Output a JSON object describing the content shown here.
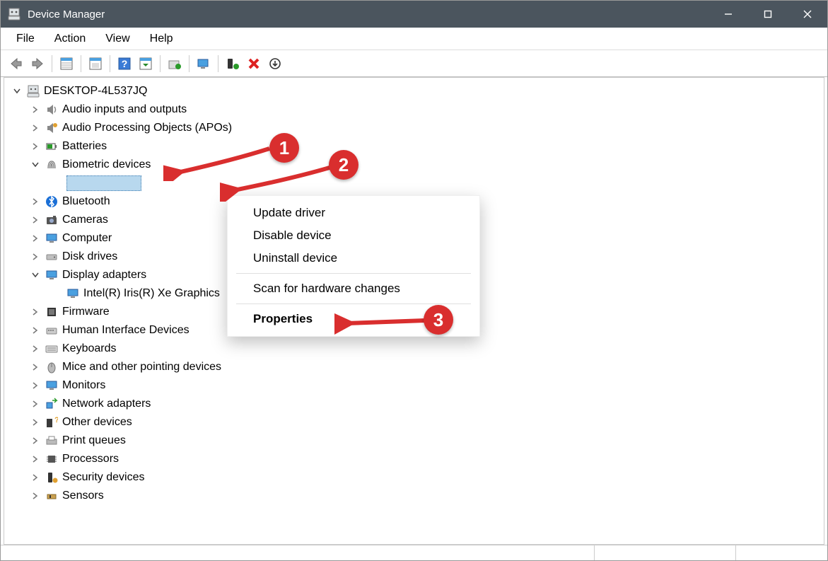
{
  "window": {
    "title": "Device Manager"
  },
  "menubar": [
    "File",
    "Action",
    "View",
    "Help"
  ],
  "tree": {
    "root": "DESKTOP-4L537JQ",
    "items": [
      {
        "label": "Audio inputs and outputs",
        "expanded": false
      },
      {
        "label": "Audio Processing Objects (APOs)",
        "expanded": false
      },
      {
        "label": "Batteries",
        "expanded": false
      },
      {
        "label": "Biometric devices",
        "expanded": true,
        "children": [
          {
            "label": "",
            "selected": true
          }
        ]
      },
      {
        "label": "Bluetooth",
        "expanded": false
      },
      {
        "label": "Cameras",
        "expanded": false
      },
      {
        "label": "Computer",
        "expanded": false
      },
      {
        "label": "Disk drives",
        "expanded": false
      },
      {
        "label": "Display adapters",
        "expanded": true,
        "children": [
          {
            "label": "Intel(R) Iris(R) Xe Graphics"
          }
        ]
      },
      {
        "label": "Firmware",
        "expanded": false
      },
      {
        "label": "Human Interface Devices",
        "expanded": false
      },
      {
        "label": "Keyboards",
        "expanded": false
      },
      {
        "label": "Mice and other pointing devices",
        "expanded": false
      },
      {
        "label": "Monitors",
        "expanded": false
      },
      {
        "label": "Network adapters",
        "expanded": false
      },
      {
        "label": "Other devices",
        "expanded": false
      },
      {
        "label": "Print queues",
        "expanded": false
      },
      {
        "label": "Processors",
        "expanded": false
      },
      {
        "label": "Security devices",
        "expanded": false
      },
      {
        "label": "Sensors",
        "expanded": false
      }
    ]
  },
  "context_menu": {
    "items": [
      {
        "label": "Update driver"
      },
      {
        "label": "Disable device"
      },
      {
        "label": "Uninstall device"
      },
      {
        "sep": true
      },
      {
        "label": "Scan for hardware changes"
      },
      {
        "sep": true
      },
      {
        "label": "Properties",
        "default": true
      }
    ]
  },
  "annotations": {
    "b1": "1",
    "b2": "2",
    "b3": "3"
  }
}
